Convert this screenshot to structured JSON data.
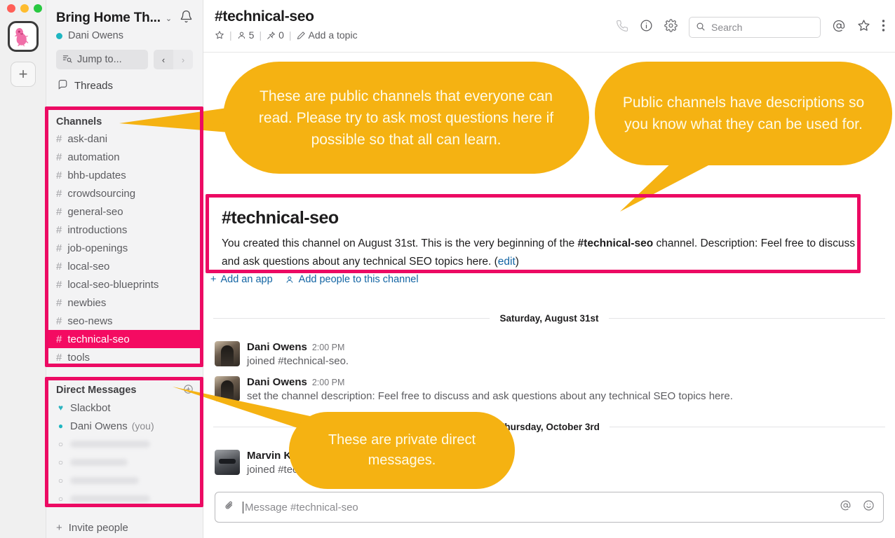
{
  "window": {
    "traffic_lights": [
      "close",
      "minimize",
      "maximize"
    ],
    "accent_pink": "#f40b62",
    "annotation_pink": "#ec0a63",
    "annotation_amber": "#f5b212"
  },
  "rail": {
    "workspace_avatar_name": "pink-dino-workspace-avatar",
    "add_workspace_label": "+"
  },
  "sidebar": {
    "workspace_name": "Bring Home Th...",
    "workspace_chevron": "⌄",
    "notifications_icon": "bell-icon",
    "user_name": "Dani Owens",
    "jump_to_placeholder": "Jump to...",
    "nav_back": "‹",
    "nav_forward": "›",
    "threads_label": "Threads",
    "channels_header": "Channels",
    "channels": [
      {
        "name": "ask-dani",
        "active": false
      },
      {
        "name": "automation",
        "active": false
      },
      {
        "name": "bhb-updates",
        "active": false
      },
      {
        "name": "crowdsourcing",
        "active": false
      },
      {
        "name": "general-seo",
        "active": false
      },
      {
        "name": "introductions",
        "active": false
      },
      {
        "name": "job-openings",
        "active": false
      },
      {
        "name": "local-seo",
        "active": false
      },
      {
        "name": "local-seo-blueprints",
        "active": false
      },
      {
        "name": "newbies",
        "active": false
      },
      {
        "name": "seo-news",
        "active": false
      },
      {
        "name": "technical-seo",
        "active": true
      },
      {
        "name": "tools",
        "active": false
      }
    ],
    "dm_header": "Direct Messages",
    "dm_add_label": "+",
    "dms": [
      {
        "name": "Slackbot",
        "presence": "heart",
        "suffix": "",
        "redacted": false
      },
      {
        "name": "Dani Owens",
        "presence": "online",
        "suffix": "(you)",
        "redacted": false
      },
      {
        "name": "",
        "presence": "offline",
        "suffix": "",
        "redacted": true
      },
      {
        "name": "",
        "presence": "offline",
        "suffix": "",
        "redacted": true
      },
      {
        "name": "",
        "presence": "offline",
        "suffix": "",
        "redacted": true
      },
      {
        "name": "",
        "presence": "offline",
        "suffix": "",
        "redacted": true
      }
    ],
    "invite_label": "Invite people"
  },
  "channel_header": {
    "title": "#technical-seo",
    "star_icon": "star-outline-icon",
    "members_count": "5",
    "pins_count": "0",
    "topic_label": "Add a topic",
    "call_icon": "phone-icon",
    "info_icon": "info-icon",
    "settings_icon": "gear-icon",
    "search_placeholder": "Search",
    "mentions_icon": "at-icon",
    "starred_icon": "star-icon",
    "more_icon": "kebab-menu-icon"
  },
  "intro": {
    "title": "#technical-seo",
    "text_part1": "You created this channel on August 31st. This is the very beginning of the ",
    "channel_bold": "#technical-seo",
    "text_part2": " channel. Description: Feel free to discuss and ask questions about any technical SEO topics here. (",
    "edit_link": "edit",
    "text_part3": ")",
    "add_app_label": "Add an app",
    "add_people_label": "Add people to this channel"
  },
  "messages": {
    "divider_1": "Saturday, August 31st",
    "divider_2": "Thursday, October 3rd",
    "items": [
      {
        "author": "Dani Owens",
        "time": "2:00 PM",
        "text": "joined #technical-seo.",
        "avatar": "dani-owens-avatar"
      },
      {
        "author": "Dani Owens",
        "time": "2:00 PM",
        "text": "set the channel description: Feel free to discuss and ask questions about any technical SEO topics here.",
        "avatar": "dani-owens-avatar"
      },
      {
        "author": "Marvin K",
        "time": "",
        "text": "joined #technical-seo.",
        "avatar": "marvin-k-avatar"
      }
    ]
  },
  "composer": {
    "attach_icon": "paperclip-icon",
    "placeholder": "Message #technical-seo",
    "mention_icon": "at-icon",
    "emoji_icon": "emoji-icon"
  },
  "annotations": {
    "callout_1": "These are public channels that everyone can read. Please try to ask most questions here if possible so that all can learn.",
    "callout_2": "Public channels have descriptions so you know what they can be used for.",
    "callout_3": "These are private direct messages."
  }
}
